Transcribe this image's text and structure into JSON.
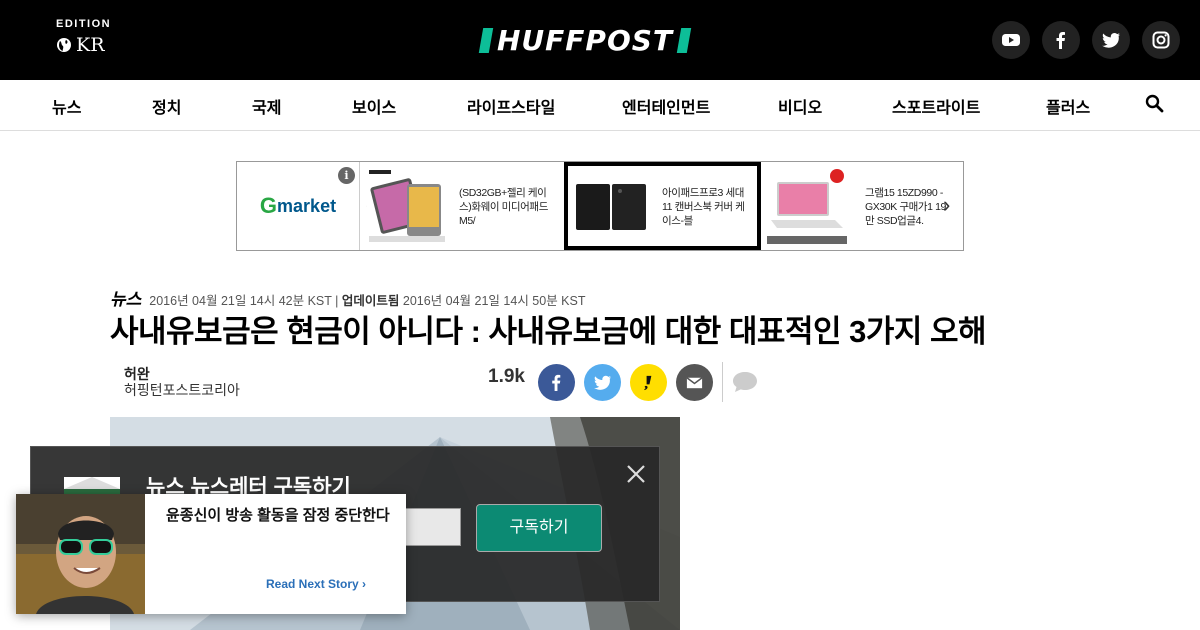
{
  "header": {
    "edition_label": "EDITION",
    "edition_code": "KR",
    "logo": "HUFFPOST",
    "socials": [
      "youtube-icon",
      "facebook-icon",
      "twitter-icon",
      "instagram-icon"
    ]
  },
  "nav": {
    "items": [
      "뉴스",
      "정치",
      "국제",
      "보이스",
      "라이프스타일",
      "엔터테인먼트",
      "비디오",
      "스포트라이트",
      "플러스"
    ]
  },
  "ad": {
    "brand_g": "G",
    "brand_rest": "market",
    "info": "i",
    "products": [
      {
        "text": "(SD32GB+젤리 케이스)화웨이 미디어패드 M5/"
      },
      {
        "text": "아이패드프로3 세대11 캔버스북 커버 케이스-블"
      },
      {
        "text": "그램15 15ZD990 -GX30K 구매가1 19만 SSD업글4."
      }
    ]
  },
  "article": {
    "category": "뉴스",
    "published": "2016년 04월 21일 14시 42분 KST",
    "separator": "|",
    "updated_label": "업데이트됨",
    "updated": "2016년 04월 21일 14시 50분 KST",
    "headline": "사내유보금은 현금이 아니다 : 사내유보금에 대한 대표적인 3가지 오해",
    "author_name": "허완",
    "author_org": "허핑턴포스트코리아",
    "share_count": "1.9k"
  },
  "newsletter": {
    "title": "뉴스 뉴스레터 구독하기",
    "subscribe_label": "구독하기"
  },
  "read_next": {
    "title": "윤종신이 방송 활동을 잠정 중단한다",
    "link_label": "Read Next Story"
  },
  "colors": {
    "brand_green": "#0dbe98",
    "facebook": "#3b5998",
    "twitter": "#55acee",
    "kakao": "#ffde00",
    "email": "#555555",
    "subscribe": "#0c8a73"
  }
}
